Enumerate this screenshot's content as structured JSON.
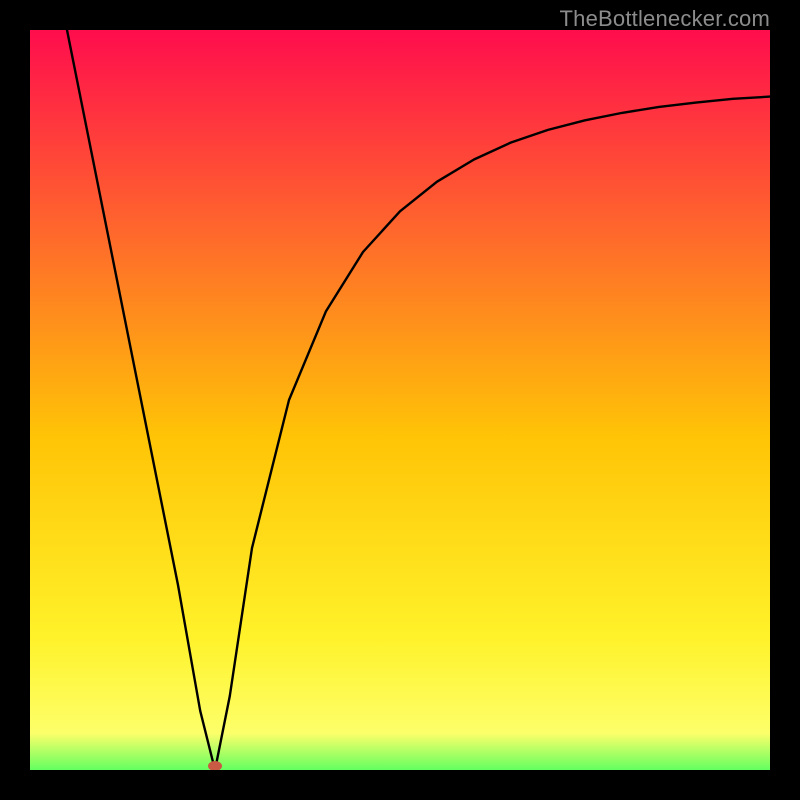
{
  "watermark": "TheBottlenecker.com",
  "chart_data": {
    "type": "line",
    "title": "",
    "xlabel": "",
    "ylabel": "",
    "xlim": [
      0,
      100
    ],
    "ylim": [
      0,
      100
    ],
    "grid": false,
    "legend": false,
    "background_gradient": {
      "top": "#ff0d4d",
      "upper_mid": "#ff6a2b",
      "mid": "#ffc406",
      "lower_mid": "#fff22a",
      "bottom_band": "#64ff60",
      "bottom_band_start_pct": 95
    },
    "marker": {
      "x": 25,
      "y": 0,
      "color": "#c95a43",
      "shape": "oval"
    },
    "series": [
      {
        "name": "left_branch",
        "x": [
          5,
          10,
          15,
          20,
          23,
          25
        ],
        "y": [
          100,
          75,
          50,
          25,
          8,
          0
        ]
      },
      {
        "name": "right_branch",
        "x": [
          25,
          27,
          30,
          35,
          40,
          45,
          50,
          55,
          60,
          65,
          70,
          75,
          80,
          85,
          90,
          95,
          100
        ],
        "y": [
          0,
          10,
          30,
          50,
          62,
          70,
          75.5,
          79.5,
          82.5,
          84.8,
          86.5,
          87.8,
          88.8,
          89.6,
          90.2,
          90.7,
          91
        ]
      }
    ]
  }
}
